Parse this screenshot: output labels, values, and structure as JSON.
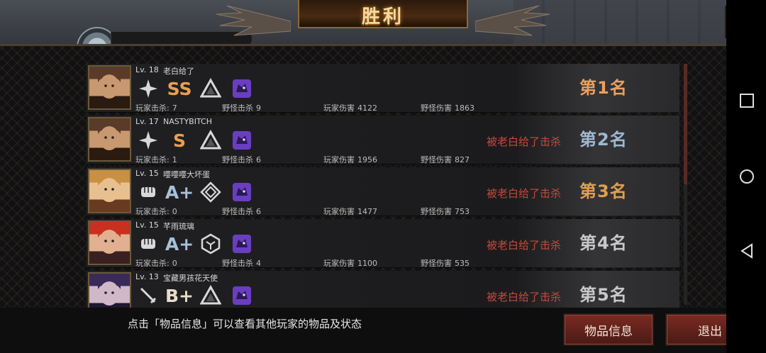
{
  "header": {
    "title": "胜利",
    "player_name_partial": "老白给了"
  },
  "players": [
    {
      "level": "Lv. 18",
      "name": "老白给了",
      "grade": "SS",
      "weapon_icon": "shuriken-icon",
      "role_icon": "triangle-icon",
      "pet_icon": "beast-icon",
      "player_kills_label": "玩家击杀:",
      "player_kills": "7",
      "monster_kills_label": "野怪击杀",
      "monster_kills": "9",
      "player_damage_label": "玩家伤害",
      "player_damage": "4122",
      "monster_damage_label": "野怪伤害",
      "monster_damage": "1863",
      "killed_by": "",
      "rank": "第1名",
      "rank_color": "#e8a060"
    },
    {
      "level": "Lv. 17",
      "name": "NASTYBITCH",
      "grade": "S",
      "weapon_icon": "shuriken-icon",
      "role_icon": "triangle-icon",
      "pet_icon": "beast-icon",
      "player_kills_label": "玩家击杀:",
      "player_kills": "1",
      "monster_kills_label": "野怪击杀",
      "monster_kills": "6",
      "player_damage_label": "玩家伤害",
      "player_damage": "1956",
      "monster_damage_label": "野怪伤害",
      "monster_damage": "827",
      "killed_by": "被老白给了击杀",
      "rank": "第2名",
      "rank_color": "#9fb8d0"
    },
    {
      "level": "Lv. 15",
      "name": "嘤嘤嘤大坏蛋",
      "grade": "A+",
      "weapon_icon": "fist-icon",
      "role_icon": "diamond-icon",
      "pet_icon": "beast-icon",
      "player_kills_label": "玩家击杀:",
      "player_kills": "0",
      "monster_kills_label": "野怪击杀",
      "monster_kills": "6",
      "player_damage_label": "玩家伤害",
      "player_damage": "1477",
      "monster_damage_label": "野怪伤害",
      "monster_damage": "753",
      "killed_by": "被老白给了击杀",
      "rank": "第3名",
      "rank_color": "#e0a050"
    },
    {
      "level": "Lv. 15",
      "name": "芊雨琉璃",
      "grade": "A+",
      "weapon_icon": "fist-icon",
      "role_icon": "hexagon-icon",
      "pet_icon": "beast-icon",
      "player_kills_label": "玩家击杀:",
      "player_kills": "0",
      "monster_kills_label": "野怪击杀",
      "monster_kills": "4",
      "player_damage_label": "玩家伤害",
      "player_damage": "1100",
      "monster_damage_label": "野怪伤害",
      "monster_damage": "535",
      "killed_by": "被老白给了击杀",
      "rank": "第4名",
      "rank_color": "#c8c8c8"
    },
    {
      "level": "Lv. 13",
      "name": "宝藏男孩花天使",
      "grade": "B+",
      "weapon_icon": "sword-icon",
      "role_icon": "triangle-icon",
      "pet_icon": "beast-icon",
      "player_kills_label": "",
      "player_kills": "",
      "monster_kills_label": "",
      "monster_kills": "",
      "player_damage_label": "",
      "player_damage": "",
      "monster_damage_label": "",
      "monster_damage": "",
      "killed_by": "被老白给了击杀",
      "rank": "第5名",
      "rank_color": "#c8c8c8"
    }
  ],
  "footer": {
    "hint": "点击「物品信息」可以查看其他玩家的物品及状态",
    "items_button": "物品信息",
    "exit_button": "退出"
  },
  "colors": {
    "grade_ss": "#e8a050",
    "grade_s": "#e8a050",
    "grade_a": "#a8c0d8",
    "grade_b": "#e8dcc8",
    "pet_purple": "#6a3ec0"
  }
}
